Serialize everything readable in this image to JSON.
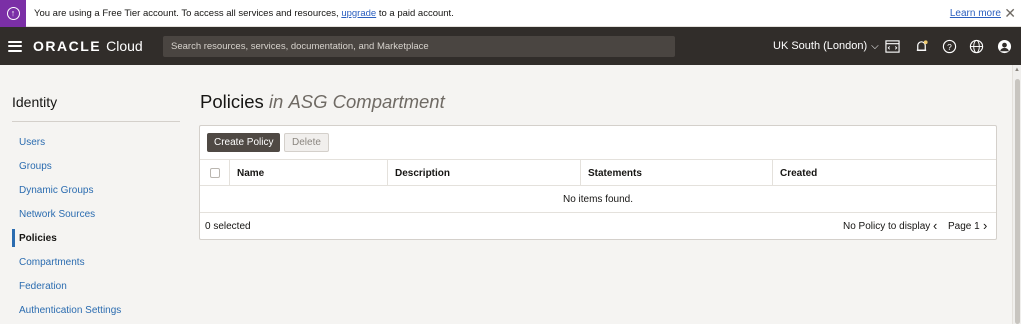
{
  "banner": {
    "icon": "upgrade-arrow-icon",
    "text_before": "You are using a Free Tier account. To access all services and resources, ",
    "link": "upgrade",
    "text_after": " to a paid account.",
    "learn_more": "Learn more",
    "color": "#7b2fa6"
  },
  "header": {
    "logo_oracle": "ORACLE",
    "logo_cloud": "Cloud",
    "search_placeholder": "Search resources, services, documentation, and Marketplace",
    "region": "UK South (London)",
    "icons": [
      "cloud-shell-icon",
      "bell-icon",
      "help-icon",
      "globe-icon",
      "profile-icon"
    ],
    "background": "#312d2a"
  },
  "sidebar": {
    "title": "Identity",
    "items": [
      {
        "label": "Users",
        "active": false
      },
      {
        "label": "Groups",
        "active": false
      },
      {
        "label": "Dynamic Groups",
        "active": false
      },
      {
        "label": "Network Sources",
        "active": false
      },
      {
        "label": "Policies",
        "active": true
      },
      {
        "label": "Compartments",
        "active": false
      },
      {
        "label": "Federation",
        "active": false
      },
      {
        "label": "Authentication Settings",
        "active": false
      }
    ]
  },
  "main": {
    "title": "Policies",
    "title_in": "in",
    "title_compartment": "ASG Compartment",
    "create_button": "Create Policy",
    "delete_button": "Delete",
    "columns": [
      "Name",
      "Description",
      "Statements",
      "Created"
    ],
    "empty_message": "No items found.",
    "selected_count": "0 selected",
    "no_display": "No Policy to display",
    "page": "Page 1"
  }
}
